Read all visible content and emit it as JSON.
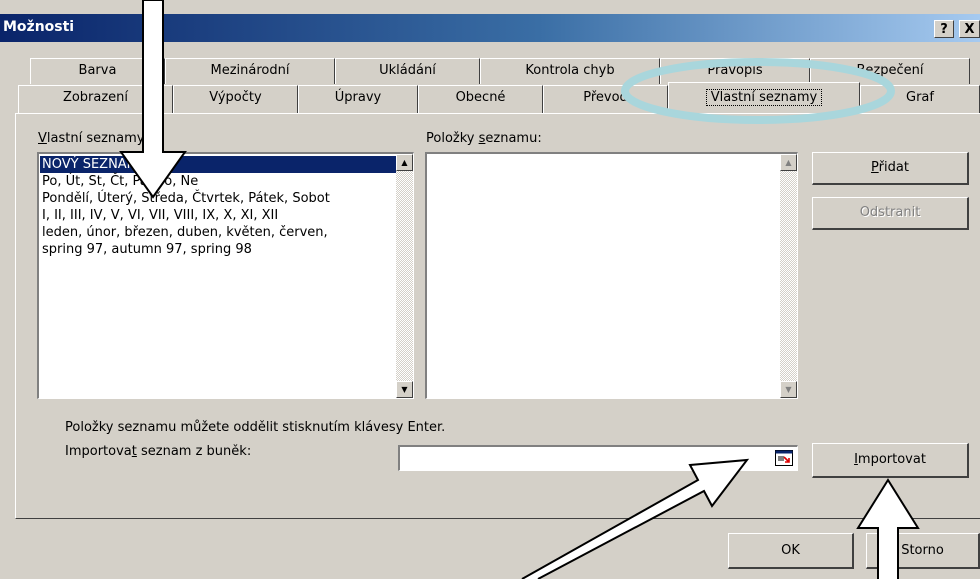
{
  "window": {
    "title": "Možnosti",
    "help_button": "?",
    "close_button": "X"
  },
  "tabs_top": [
    "Barva",
    "Mezinárodní",
    "Ukládání",
    "Kontrola chyb",
    "Pravopis",
    "Bezpečení"
  ],
  "tabs_bottom": [
    "Zobrazení",
    "Výpočty",
    "Úpravy",
    "Obecné",
    "Převod",
    "Vlastní seznamy",
    "Graf"
  ],
  "active_tab": "Vlastní seznamy",
  "custom_lists": {
    "label_prefix": "V",
    "label_rest": "lastní seznamy:",
    "items": [
      "NOVÝ SEZNAM",
      "Po, Út, St, Čt, Pá, So, Ne",
      "Pondělí, Úterý, Středa, Čtvrtek, Pátek, Sobot",
      "I, II, III, IV, V, VI, VII, VIII, IX, X, XI, XII",
      "leden, únor, březen, duben, květen, červen,",
      "spring 97, autumn 97, spring 98"
    ],
    "selected_index": 0
  },
  "list_entries": {
    "label_before": "Položky ",
    "label_accel": "s",
    "label_after": "eznamu:",
    "value": ""
  },
  "buttons": {
    "add_accel": "P",
    "add_rest": "řidat",
    "remove": "Odstranit",
    "import_accel": "I",
    "import_rest": "mportovat",
    "ok": "OK",
    "cancel": "Storno"
  },
  "hint_text": "Položky seznamu můžete oddělit stisknutím klávesy Enter.",
  "import_label": {
    "before": "Importova",
    "accel": "t",
    "after": " seznam z buněk:"
  },
  "import_field_value": "",
  "annotations": {
    "highlight_color": "#a9d6dc",
    "highlight_stroke": "#5a8c98"
  }
}
